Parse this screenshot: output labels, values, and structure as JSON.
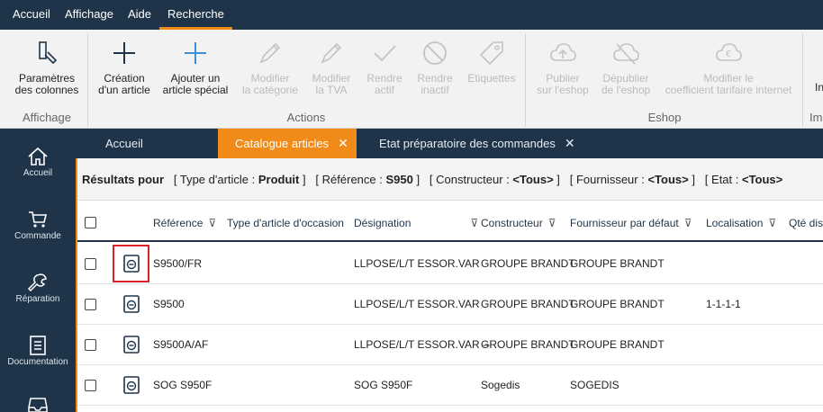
{
  "menu": {
    "items": [
      "Accueil",
      "Affichage",
      "Aide",
      "Recherche"
    ]
  },
  "ribbon": {
    "affichage": {
      "group_label": "Affichage",
      "params_line1": "Paramètres",
      "params_line2": "des colonnes"
    },
    "actions": {
      "group_label": "Actions",
      "creation_line1": "Création",
      "creation_line2": "d'un article",
      "ajouter_line1": "Ajouter un",
      "ajouter_line2": "article spécial",
      "modcat_line1": "Modifier",
      "modcat_line2": "la catégorie",
      "modtva_line1": "Modifier",
      "modtva_line2": "la TVA",
      "actif_line1": "Rendre",
      "actif_line2": "actif",
      "inactif_line1": "Rendre",
      "inactif_line2": "inactif",
      "etiquettes": "Etiquettes"
    },
    "eshop": {
      "group_label": "Eshop",
      "publier_line1": "Publier",
      "publier_line2": "sur l'eshop",
      "depublier_line1": "Dépublier",
      "depublier_line2": "de l'eshop",
      "coef_line1": "Modifier le",
      "coef_line2": "coefficient tarifaire internet"
    },
    "partial": {
      "btn_line1": "In",
      "group_label": "Im"
    }
  },
  "sidebar": {
    "items": [
      "Accueil",
      "Commande",
      "Réparation",
      "Documentation"
    ]
  },
  "tabs": [
    {
      "label": "Accueil"
    },
    {
      "label": "Catalogue articles",
      "close": "✕"
    },
    {
      "label": "Etat préparatoire des commandes",
      "close": "✕"
    }
  ],
  "filters": {
    "prefix": "Résultats pour",
    "f1_label": "[ Type d'article : ",
    "f1_value": "Produit",
    "f2_label": " ]   [ Référence : ",
    "f2_value": "S950",
    "f3_label": " ]   [ Constructeur : ",
    "f3_value": "<Tous>",
    "f4_label": " ]   [ Fournisseur : ",
    "f4_value": "<Tous>",
    "f5_label": " ]   [ Etat : ",
    "f5_value": "<Tous>"
  },
  "table": {
    "columns": [
      "Référence",
      "Type d'article d'occasion",
      "Désignation",
      "Constructeur",
      "Fournisseur par défaut",
      "Localisation",
      "Qté dis"
    ],
    "rows": [
      {
        "reference": "S9500/FR",
        "type_occasion": "",
        "designation": "LLPOSE/L/T ESSOR.VAR",
        "constructeur": "GROUPE BRANDT",
        "fournisseur": "GROUPE BRANDT",
        "localisation": ""
      },
      {
        "reference": "S9500",
        "type_occasion": "",
        "designation": "LLPOSE/L/T ESSOR.VAR",
        "constructeur": "GROUPE BRANDT",
        "fournisseur": "GROUPE BRANDT",
        "localisation": "1-1-1-1"
      },
      {
        "reference": "S9500A/AF",
        "type_occasion": "",
        "designation": "LLPOSE/L/T ESSOR.VAR --",
        "constructeur": "GROUPE BRANDT",
        "fournisseur": "GROUPE BRANDT",
        "localisation": ""
      },
      {
        "reference": "SOG S950F",
        "type_occasion": "",
        "designation": "SOG S950F",
        "constructeur": "Sogedis",
        "fournisseur": "SOGEDIS",
        "localisation": ""
      }
    ]
  },
  "colors": {
    "navy": "#1f3448",
    "accent": "#f08a18",
    "highlight": "#d8232a",
    "disabled": "#b8bcc0"
  }
}
